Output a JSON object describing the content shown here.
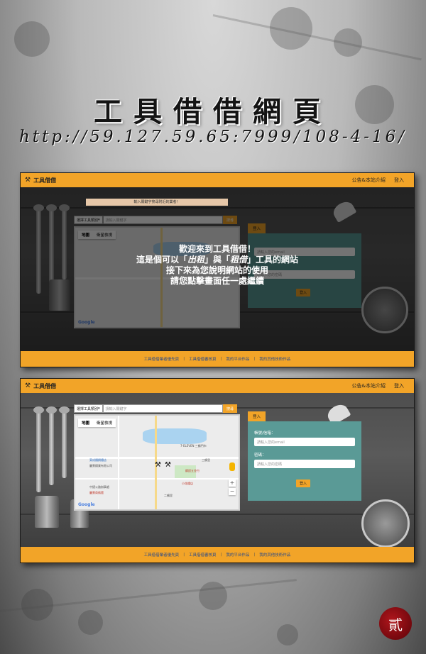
{
  "header": {
    "title": "工具借借網頁",
    "url": "http://59.127.59.65:7999/108-4-16/"
  },
  "site": {
    "brand": "工具借借",
    "nav_about": "公告&本站介紹",
    "nav_login": "登入",
    "footer_links": [
      "工具借借業者優先頁",
      "工具借借審核頁",
      "我的平台作品",
      "我的其他技術作品"
    ],
    "search_category": "選擇工具類別",
    "search_placeholder": "請輸入關鍵字",
    "search_button": "搜尋",
    "map_tab_map": "地圖",
    "map_tab_satellite": "衛星檢視",
    "login_tab": "登入",
    "account_label": "帳號/信箱：",
    "account_placeholder": "請輸入您的email",
    "password_label": "密碼：",
    "password_placeholder": "請輸入您的密碼",
    "login_button": "登入",
    "overlay_banner": "輸入關鍵字搜尋附近的業者！"
  },
  "welcome": {
    "line1": "歡迎來到工具借借！",
    "line2_a": "這是個可以「",
    "line2_rent_out": "出租",
    "line2_b": "」與「",
    "line2_rent": "租借",
    "line2_c": "」工具的網站",
    "line3": "接下來為您說明網站的使用",
    "line4": "請您點擊畫面任一處繼續"
  },
  "map_labels": [
    "7-ELEVEN 三鶴門市",
    "東成鐵鋼鐵店",
    "麗景鋼業有限公司",
    "中捷公路辦事處",
    "麗景商務館",
    "小花鐵店",
    "鋼鋁五金行",
    "二鶴里",
    "三鶴里",
    "Google"
  ],
  "seal": {
    "text": "貳"
  },
  "colors": {
    "accent": "#f2a428",
    "login_panel": "#5a9a96",
    "seal": "#9b1016"
  }
}
